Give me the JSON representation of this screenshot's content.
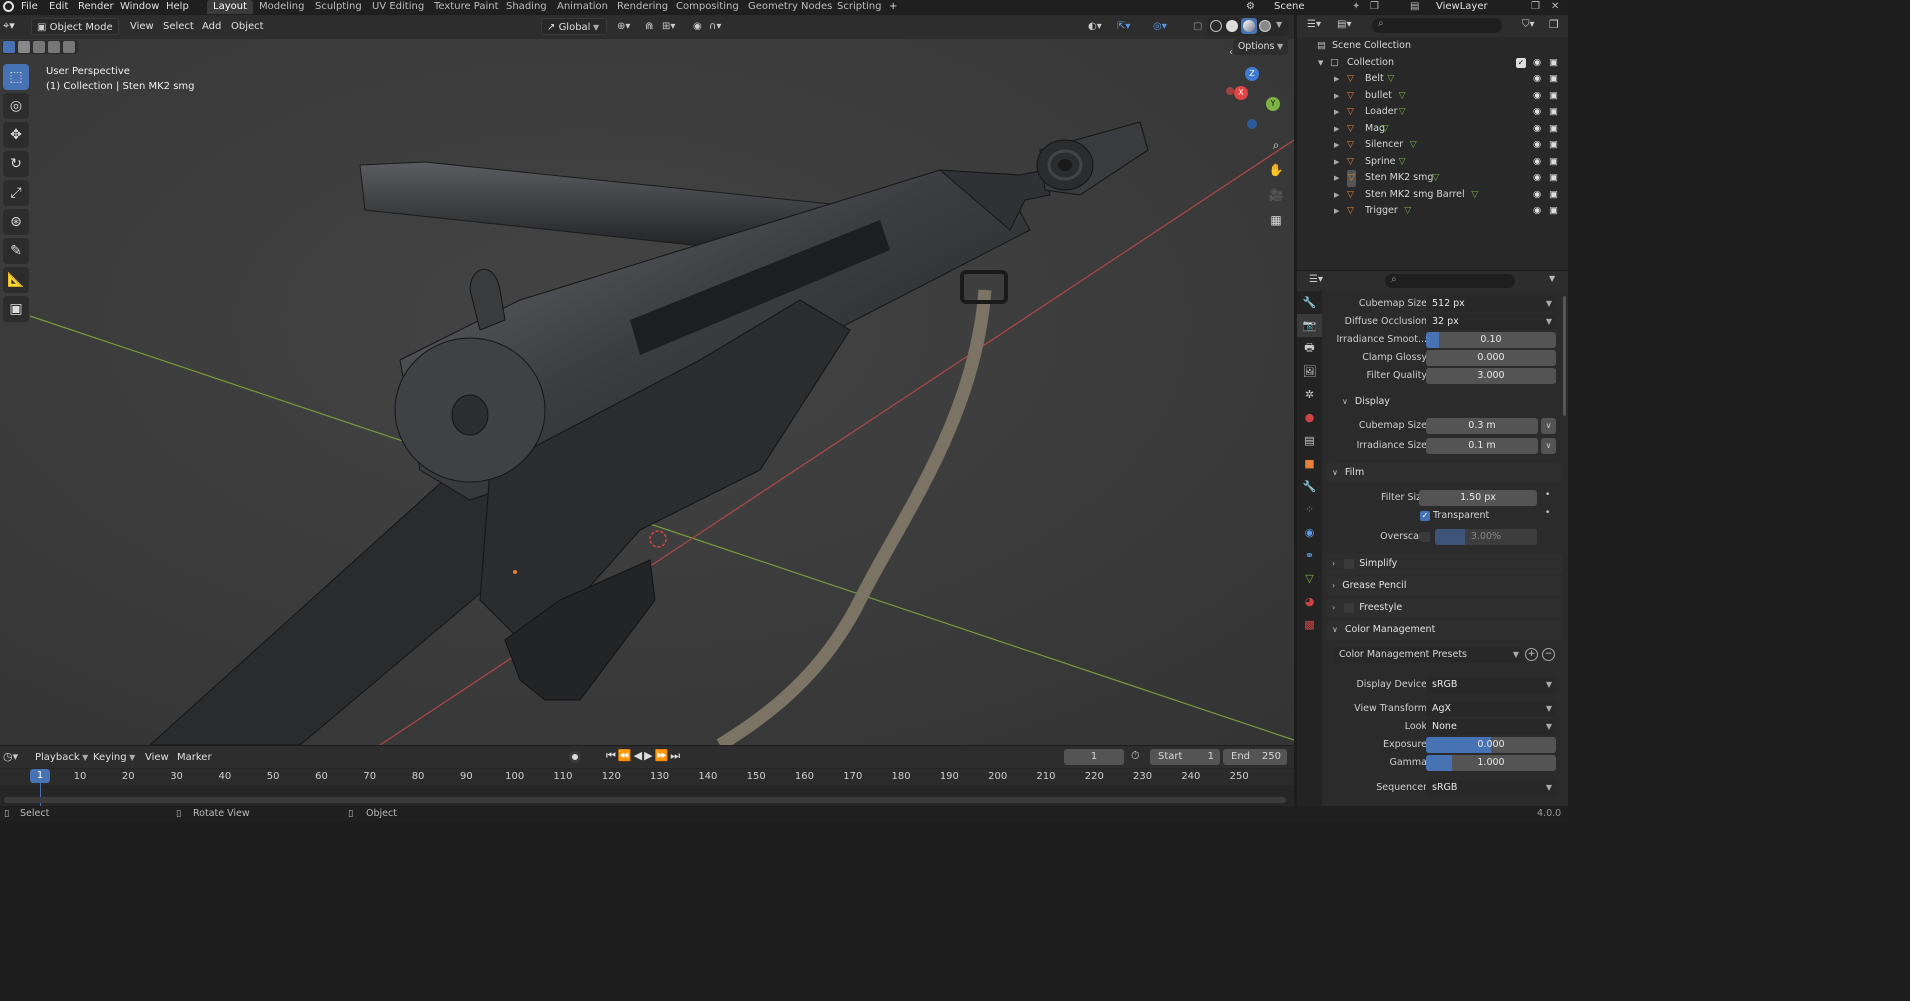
{
  "topbar": {
    "menus": [
      "File",
      "Edit",
      "Render",
      "Window",
      "Help"
    ],
    "workspaces": [
      "Layout",
      "Modeling",
      "Sculpting",
      "UV Editing",
      "Texture Paint",
      "Shading",
      "Animation",
      "Rendering",
      "Compositing",
      "Geometry Nodes",
      "Scripting"
    ],
    "active_workspace": "Layout",
    "add_tab": "+",
    "scene_label": "Scene",
    "viewlayer_label": "ViewLayer"
  },
  "viewport_header": {
    "mode": "Object Mode",
    "menus": [
      "View",
      "Select",
      "Add",
      "Object"
    ],
    "transform_orientation": "Global",
    "options_label": "Options"
  },
  "viewport": {
    "perspective_label": "User Perspective",
    "collection_label": "(1) Collection | Sten MK2 smg",
    "gizmo": {
      "x": "X",
      "y": "Y",
      "z": "Z"
    }
  },
  "outliner": {
    "root": "Scene Collection",
    "collection": "Collection",
    "items": [
      "Belt",
      "bullet",
      "Loader",
      "Mag",
      "Silencer",
      "Sprine",
      "Sten MK2 smg",
      "Sten MK2 smg Barrel",
      "Trigger"
    ],
    "active_item": "Sten MK2 smg"
  },
  "properties": {
    "rows_top": [
      {
        "label": "Cubemap Size",
        "value": "512 px",
        "kind": "dropdown"
      },
      {
        "label": "Diffuse Occlusion",
        "value": "32 px",
        "kind": "dropdown"
      },
      {
        "label": "Irradiance Smoot...",
        "value": "0.10",
        "kind": "slider",
        "fill": 0.1
      },
      {
        "label": "Clamp Glossy",
        "value": "0.000",
        "kind": "field"
      },
      {
        "label": "Filter Quality",
        "value": "3.000",
        "kind": "field"
      }
    ],
    "display_section": "Display",
    "display_rows": [
      {
        "label": "Cubemap Size",
        "value": "0.3 m"
      },
      {
        "label": "Irradiance Size",
        "value": "0.1 m"
      }
    ],
    "film_section": "Film",
    "film_filter_label": "Filter Size",
    "film_filter_value": "1.50 px",
    "film_transparent_label": "Transparent",
    "film_overscan_label": "Overscan",
    "film_overscan_value": "3.00%",
    "simplify_section": "Simplify",
    "grease_pencil_section": "Grease Pencil",
    "freestyle_section": "Freestyle",
    "color_mgmt_section": "Color Management",
    "color_presets": "Color Management Presets",
    "color_rows": [
      {
        "label": "Display Device",
        "value": "sRGB",
        "kind": "dropdown"
      },
      {
        "label": "View Transform",
        "value": "AgX",
        "kind": "dropdown"
      },
      {
        "label": "Look",
        "value": "None",
        "kind": "dropdown"
      },
      {
        "label": "Exposure",
        "value": "0.000",
        "kind": "slider",
        "fill": 0.5
      },
      {
        "label": "Gamma",
        "value": "1.000",
        "kind": "slider",
        "fill": 0.2
      },
      {
        "label": "Sequencer",
        "value": "sRGB",
        "kind": "dropdown"
      }
    ]
  },
  "timeline": {
    "menus": [
      "Playback",
      "Keying",
      "View",
      "Marker"
    ],
    "current_frame": "1",
    "start_label": "Start",
    "start_value": "1",
    "end_label": "End",
    "end_value": "250",
    "ticks": [
      "10",
      "20",
      "30",
      "40",
      "50",
      "60",
      "70",
      "80",
      "90",
      "100",
      "110",
      "120",
      "130",
      "140",
      "150",
      "160",
      "170",
      "180",
      "190",
      "200",
      "210",
      "220",
      "230",
      "240",
      "250"
    ],
    "playhead": "1"
  },
  "statusbar": {
    "select": "Select",
    "rotate": "Rotate View",
    "object": "Object",
    "version": "4.0.0"
  },
  "colors": {
    "accent": "#4772b3",
    "axis_x": "#e04444",
    "axis_y": "#7cb342",
    "axis_z": "#3e7bd6",
    "orange": "#e5813a"
  }
}
